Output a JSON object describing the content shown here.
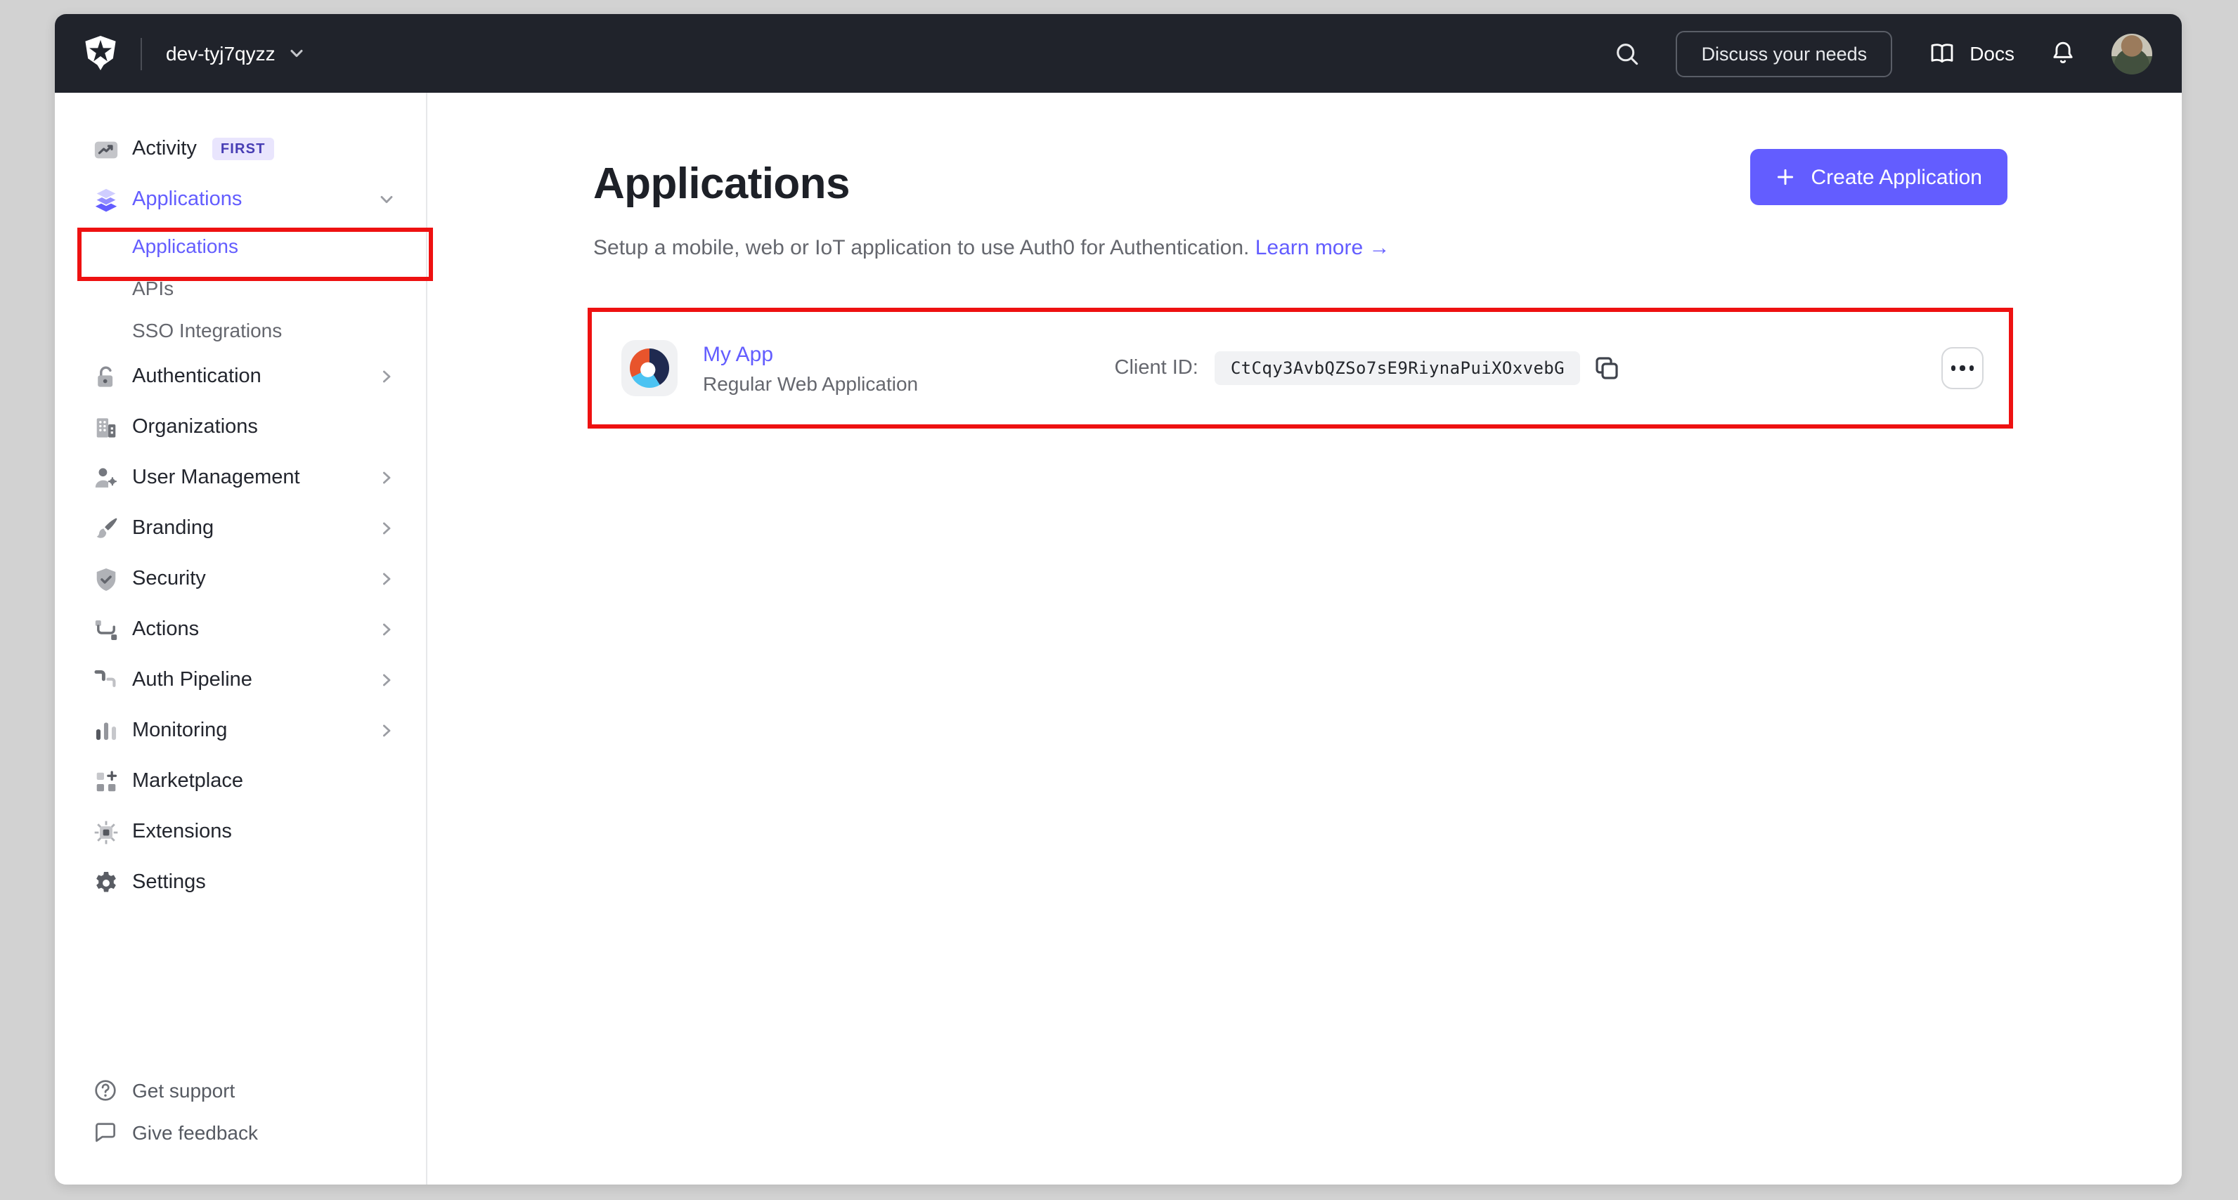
{
  "topbar": {
    "tenant": "dev-tyj7qyzz",
    "discuss_label": "Discuss your needs",
    "docs_label": "Docs"
  },
  "sidebar": {
    "items": [
      {
        "label": "Activity",
        "badge": "FIRST"
      },
      {
        "label": "Applications",
        "active": true,
        "expanded": true
      },
      {
        "label": "Authentication"
      },
      {
        "label": "Organizations"
      },
      {
        "label": "User Management"
      },
      {
        "label": "Branding"
      },
      {
        "label": "Security"
      },
      {
        "label": "Actions"
      },
      {
        "label": "Auth Pipeline"
      },
      {
        "label": "Monitoring"
      },
      {
        "label": "Marketplace"
      },
      {
        "label": "Extensions"
      },
      {
        "label": "Settings"
      }
    ],
    "applications_children": [
      {
        "label": "Applications",
        "active": true
      },
      {
        "label": "APIs"
      },
      {
        "label": "SSO Integrations"
      }
    ],
    "footer": [
      {
        "label": "Get support"
      },
      {
        "label": "Give feedback"
      }
    ]
  },
  "main": {
    "title": "Applications",
    "create_button": "Create Application",
    "subtitle": "Setup a mobile, web or IoT application to use Auth0 for Authentication.",
    "learn_more": "Learn more",
    "learn_more_arrow": "→",
    "app": {
      "name": "My App",
      "type": "Regular Web Application",
      "client_id_label": "Client ID:",
      "client_id": "CtCqy3AvbQZSo7sE9RiynaPuiXOxvebG"
    }
  },
  "colors": {
    "accent": "#635dff",
    "topbar_bg": "#20232b",
    "annotation_red": "#ee1111",
    "app_logo": {
      "orange": "#e8542c",
      "navy": "#1f2a50",
      "blue": "#4cc3f2"
    }
  }
}
